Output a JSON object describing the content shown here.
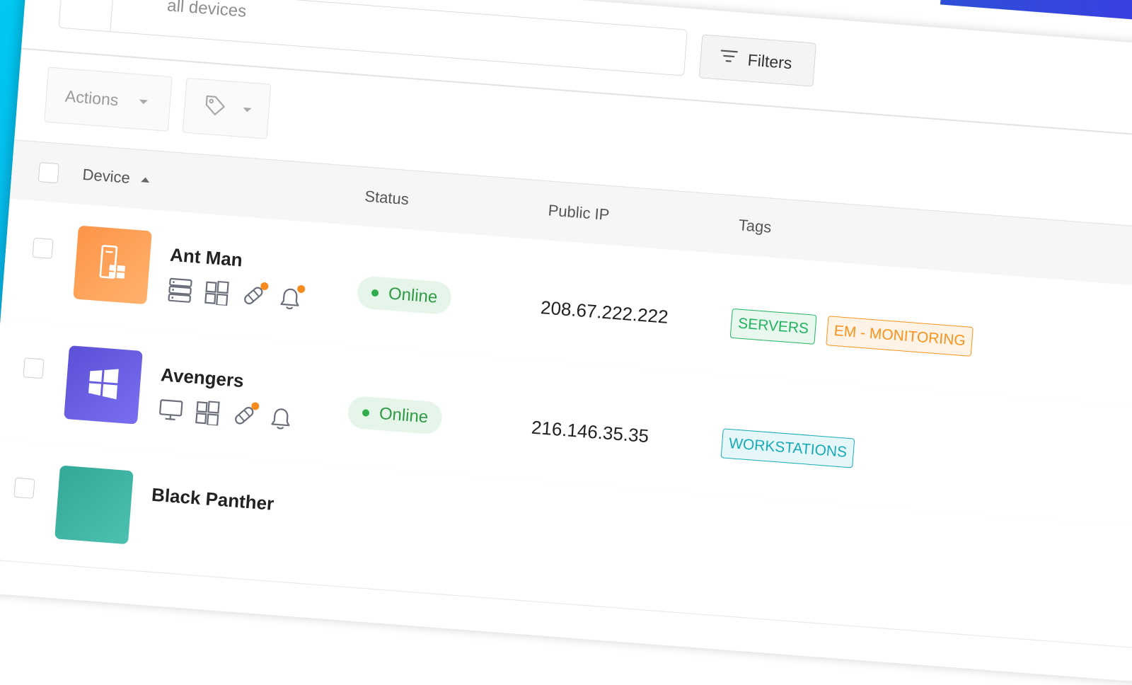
{
  "search": {
    "placeholder_visible": "all devices"
  },
  "toolbar": {
    "filters_label": "Filters",
    "actions_label": "Actions"
  },
  "table": {
    "columns": {
      "device": "Device",
      "status": "Status",
      "public_ip": "Public IP",
      "tags": "Tags"
    },
    "rows": [
      {
        "name": "Ant Man",
        "status": "Online",
        "ip": "208.67.222.222",
        "avatar_color": "#fd9a4c",
        "tags": [
          {
            "label": "SERVERS",
            "color": "#22b35f",
            "bg": "#e9f8ee"
          },
          {
            "label": "EM - MONITORING",
            "color": "#f7931e",
            "bg": "#fff3e6"
          }
        ]
      },
      {
        "name": "Avengers",
        "status": "Online",
        "ip": "216.146.35.35",
        "avatar_color": "#6a5fe0",
        "tags": [
          {
            "label": "WORKSTATIONS",
            "color": "#18aab8",
            "bg": "#e6f7f9"
          }
        ]
      },
      {
        "name": "Black Panther",
        "avatar_color": "#3eb4a4"
      }
    ]
  },
  "colors": {
    "left_strip": "#00c8f2",
    "corner_accent": "#2e4fd8",
    "online_green": "#2e9a45",
    "notification_dot": "#f98b1e"
  }
}
